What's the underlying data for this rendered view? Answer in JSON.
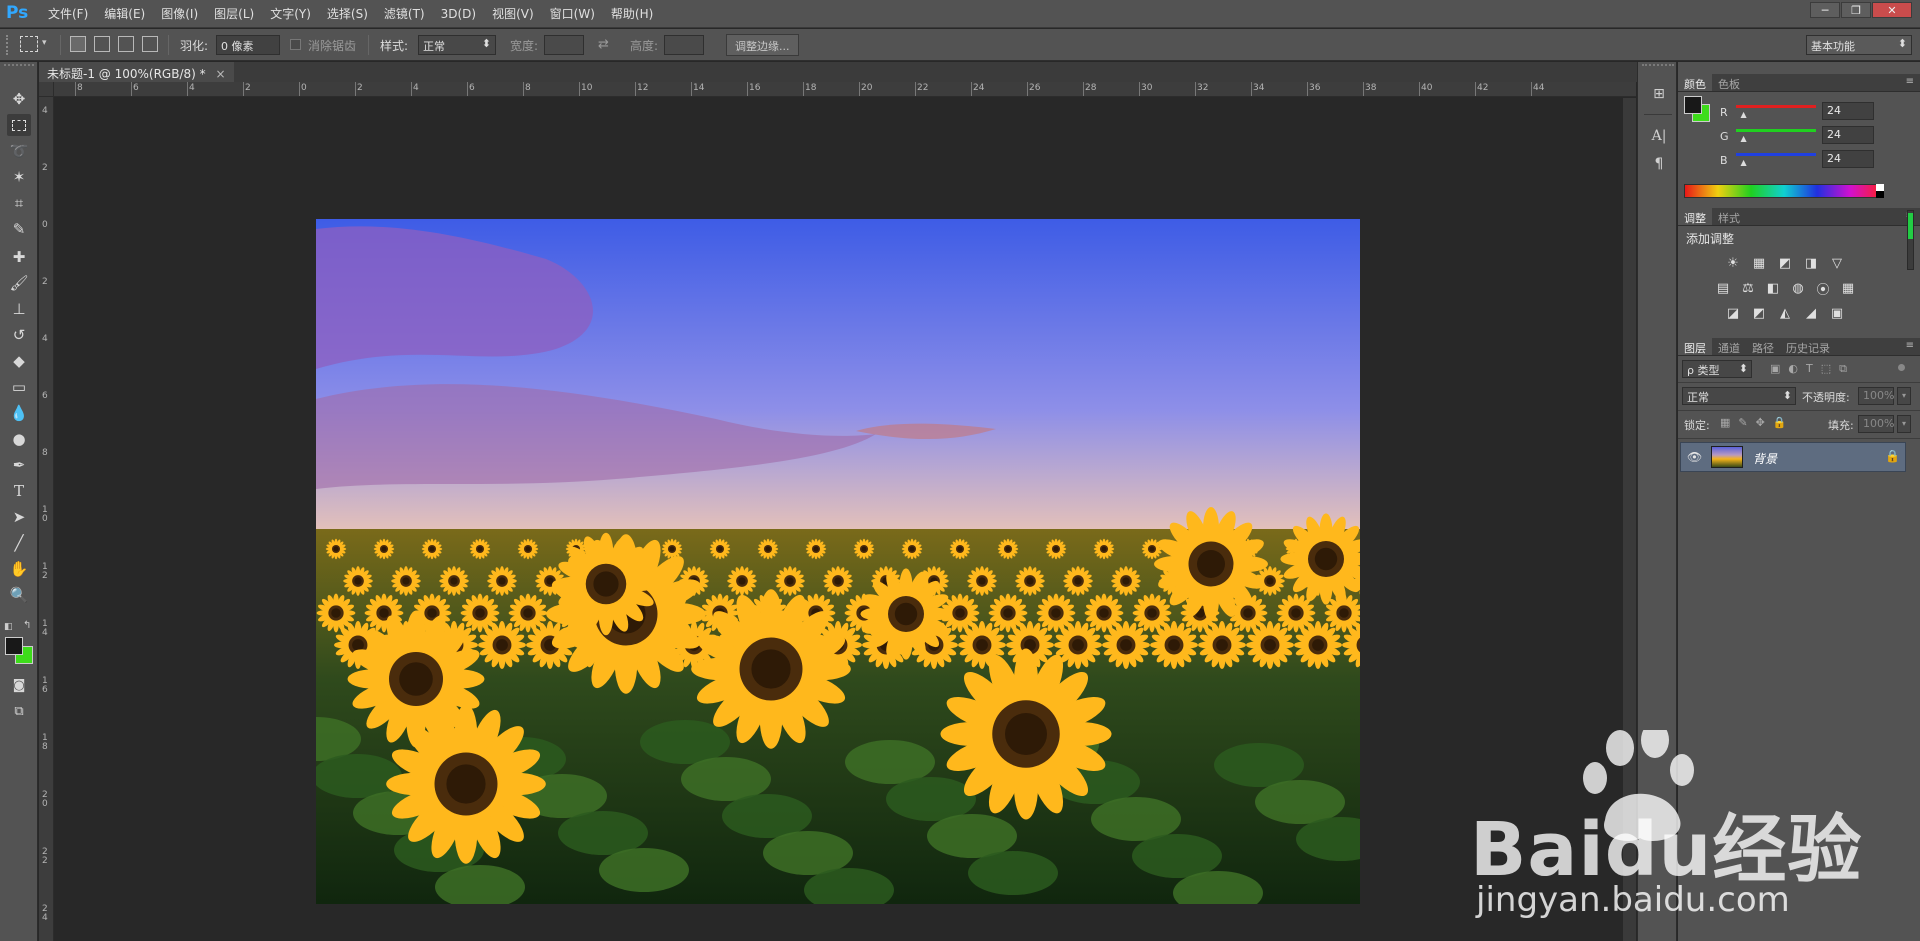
{
  "app": {
    "logo": "Ps"
  },
  "menu": [
    "文件(F)",
    "编辑(E)",
    "图像(I)",
    "图层(L)",
    "文字(Y)",
    "选择(S)",
    "滤镜(T)",
    "3D(D)",
    "视图(V)",
    "窗口(W)",
    "帮助(H)"
  ],
  "window_controls": {
    "minimize": "─",
    "restore": "❐",
    "close": "✕"
  },
  "options": {
    "feather_label": "羽化:",
    "feather_value": "0 像素",
    "antialias_label": "消除锯齿",
    "style_label": "样式:",
    "style_value": "正常",
    "width_label": "宽度:",
    "height_label": "高度:",
    "refine_edge": "调整边缘...",
    "workspace": "基本功能"
  },
  "document": {
    "tab_title": "未标题-1 @ 100%(RGB/8) *",
    "close": "×"
  },
  "ruler": {
    "h_labels": [
      "8",
      "6",
      "4",
      "2",
      "0",
      "2",
      "4",
      "6",
      "8",
      "10",
      "12",
      "14",
      "16",
      "18",
      "20",
      "22",
      "24",
      "26",
      "28",
      "30",
      "32",
      "34",
      "36",
      "38",
      "40",
      "42",
      "44"
    ],
    "v_labels": [
      "4",
      "2",
      "0",
      "2",
      "4",
      "6",
      "8",
      "1\n0",
      "1\n2",
      "1\n4",
      "1\n6",
      "1\n8",
      "2\n0",
      "2\n2",
      "2\n4"
    ]
  },
  "color_panel": {
    "tabs": [
      "颜色",
      "色板"
    ],
    "channels": [
      {
        "label": "R",
        "value": "24",
        "color": "#e02020"
      },
      {
        "label": "G",
        "value": "24",
        "color": "#20d020"
      },
      {
        "label": "B",
        "value": "24",
        "color": "#2040e0"
      }
    ],
    "foreground": "#181818",
    "background": "#3ddc1a"
  },
  "adjust_panel": {
    "tabs": [
      "调整",
      "样式"
    ],
    "title": "添加调整",
    "icons_row1": [
      "☀",
      "▦",
      "◩",
      "◨",
      "▽"
    ],
    "icons_row2": [
      "▤",
      "⚖",
      "◧",
      "◍",
      "⦿",
      "▦"
    ],
    "icons_row3": [
      "◪",
      "◩",
      "◭",
      "◢",
      "▣"
    ]
  },
  "layers_panel": {
    "tabs": [
      "图层",
      "通道",
      "路径",
      "历史记录"
    ],
    "filter_label": "ρ 类型",
    "blend_mode": "正常",
    "opacity_label": "不透明度:",
    "opacity_value": "100%",
    "lock_label": "锁定:",
    "fill_label": "填充:",
    "fill_value": "100%",
    "layers": [
      {
        "name": "背景",
        "visible": true,
        "locked": true
      }
    ]
  },
  "watermark": {
    "brand": "Baidu经验",
    "url": "jingyan.baidu.com"
  }
}
